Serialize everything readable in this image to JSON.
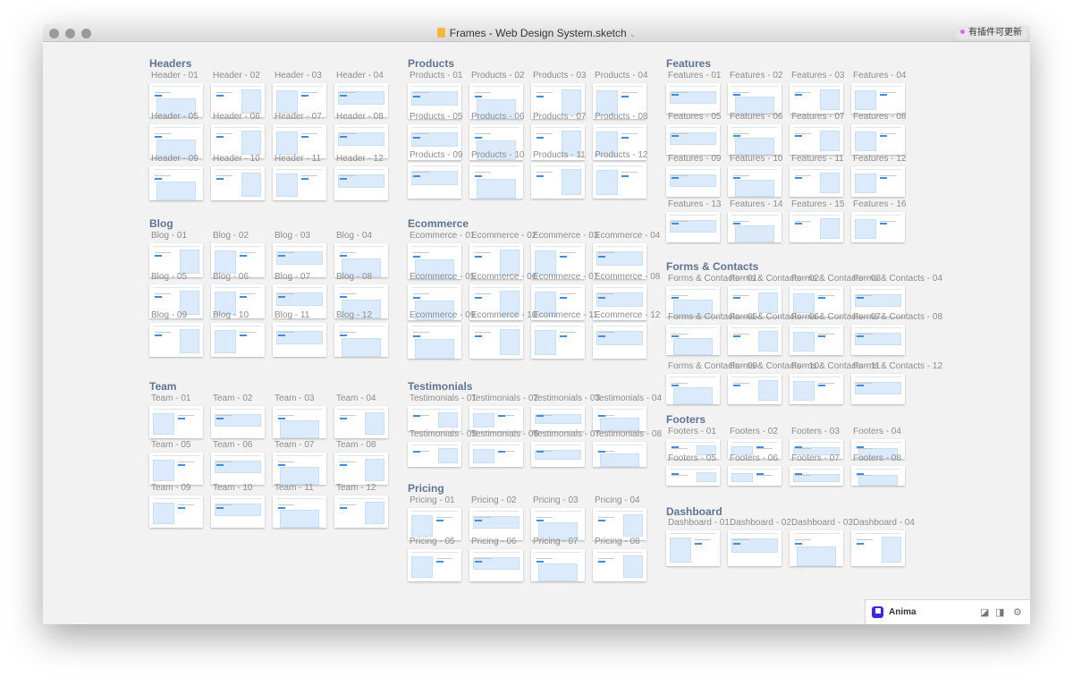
{
  "window": {
    "title": "Frames - Web Design System.sketch",
    "update_badge": "有插件可更新"
  },
  "sections": [
    {
      "title": "Headers",
      "prefix": "Header",
      "count": 12
    },
    {
      "title": "Blog",
      "prefix": "Blog",
      "count": 12
    },
    {
      "title": "Team",
      "prefix": "Team",
      "count": 12
    },
    {
      "title": "Products",
      "prefix": "Products",
      "count": 12
    },
    {
      "title": "Ecommerce",
      "prefix": "Ecommerce",
      "count": 12
    },
    {
      "title": "Testimonials",
      "prefix": "Testimonials",
      "count": 8
    },
    {
      "title": "Pricing",
      "prefix": "Pricing",
      "count": 8
    },
    {
      "title": "Features",
      "prefix": "Features",
      "count": 16
    },
    {
      "title": "Forms & Contacts",
      "prefix": "Forms & Contacts",
      "count": 12
    },
    {
      "title": "Footers",
      "prefix": "Footers",
      "count": 8
    },
    {
      "title": "Dashboard",
      "prefix": "Dashboard",
      "count": 4
    }
  ],
  "anima": {
    "name": "Anima",
    "icons": [
      "resize-icon",
      "panel-icon",
      "gear-icon"
    ]
  },
  "colors": {
    "accent": "#3d8ee3",
    "placeholder": "#dcebfb",
    "section_title": "#5f7590"
  }
}
